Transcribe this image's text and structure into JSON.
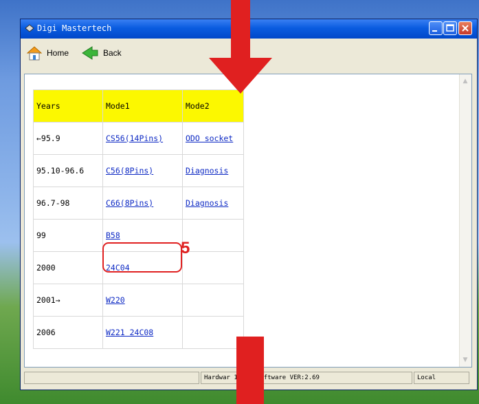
{
  "window": {
    "title": "Digi Mastertech",
    "controls": {
      "minimize_icon": "minimize-icon",
      "maximize_icon": "maximize-icon",
      "close_icon": "close-icon"
    }
  },
  "toolbar": {
    "home_label": "Home",
    "back_label": "Back"
  },
  "table": {
    "headers": [
      "Years",
      "Mode1",
      "Mode2"
    ],
    "rows": [
      {
        "years": "←95.9",
        "mode1": "CS56(14Pins)",
        "mode2": "ODO socket"
      },
      {
        "years": "95.10-96.6",
        "mode1": "C56(8Pins)",
        "mode2": "Diagnosis"
      },
      {
        "years": "96.7-98",
        "mode1": "C66(8Pins)",
        "mode2": "Diagnosis"
      },
      {
        "years": "99",
        "mode1": "B58",
        "mode2": ""
      },
      {
        "years": "2000",
        "mode1": "24C04",
        "mode2": ""
      },
      {
        "years": "2001→",
        "mode1": "W220",
        "mode2": ""
      },
      {
        "years": "2006",
        "mode1": "W221 24C08",
        "mode2": ""
      }
    ]
  },
  "annotation": {
    "step_number": "5",
    "color": "#e02020"
  },
  "statusbar": {
    "left": "",
    "middle": "Hardwar     1230-  Software VER:2.69",
    "right": "Local"
  },
  "colors": {
    "header_bg": "#fcf800",
    "link": "#0d29c4",
    "titlebar": "#0a5ce0",
    "arrow": "#e02020"
  }
}
